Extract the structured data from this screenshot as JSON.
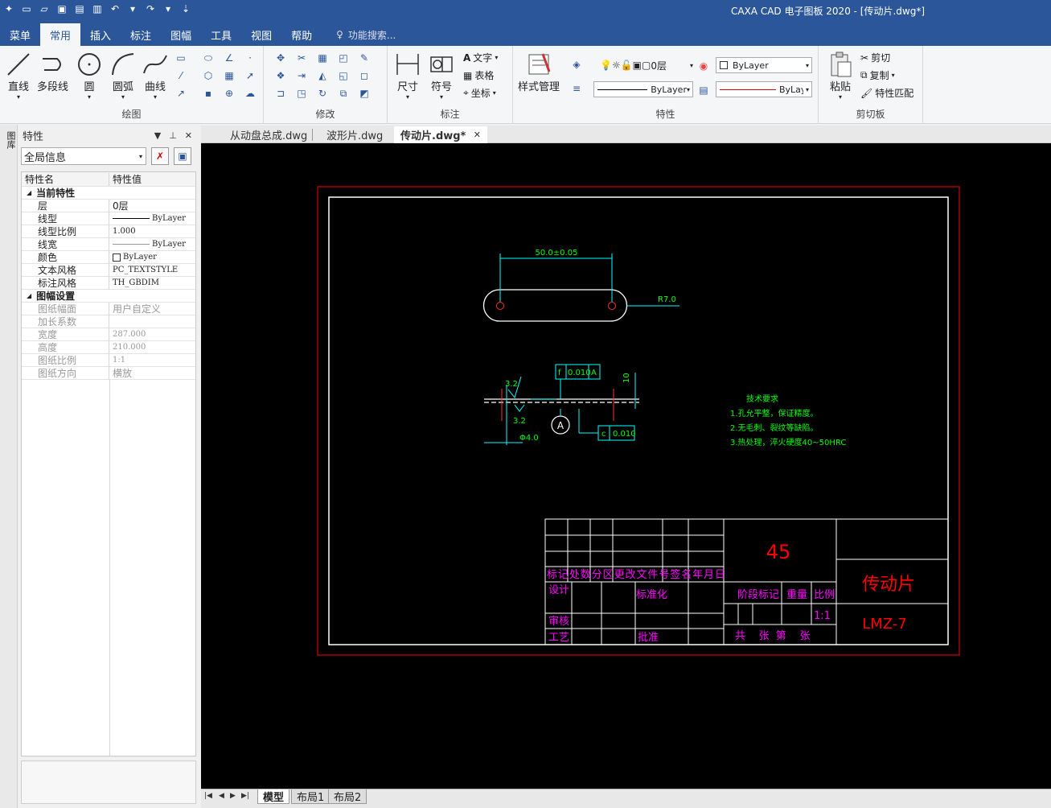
{
  "window_title": "CAXA CAD 电子图板 2020 - [传动片.dwg*]",
  "menu_tabs": [
    "菜单",
    "常用",
    "插入",
    "标注",
    "图幅",
    "工具",
    "视图",
    "帮助"
  ],
  "active_menu_tab": "常用",
  "search_placeholder": "功能搜索...",
  "ribbon": {
    "draw": {
      "label": "绘图",
      "line": "直线",
      "polyline": "多段线",
      "circle": "圆",
      "arc": "圆弧",
      "curve": "曲线"
    },
    "modify": {
      "label": "修改"
    },
    "annotate": {
      "label": "标注",
      "dimension": "尺寸",
      "symbol": "符号",
      "text": "文字",
      "table": "表格",
      "coord": "坐标"
    },
    "properties": {
      "label": "特性",
      "style_mgr": "样式管理",
      "layer": "0层",
      "color": "ByLayer",
      "linetype": "ByLayer",
      "lineweight": "ByLayer"
    },
    "clipboard": {
      "label": "剪切板",
      "paste": "粘贴",
      "cut": "剪切",
      "copy": "复制",
      "match": "特性匹配"
    }
  },
  "side_strip_label": "图库",
  "panel": {
    "title": "特性",
    "selector": "全局信息",
    "col_name": "特性名",
    "col_value": "特性值",
    "cat_current": "当前特性",
    "current": [
      {
        "name": "层",
        "value": "0层"
      },
      {
        "name": "线型",
        "value": "ByLayer"
      },
      {
        "name": "线型比例",
        "value": "1.000"
      },
      {
        "name": "线宽",
        "value": "ByLayer"
      },
      {
        "name": "颜色",
        "value": "ByLayer"
      },
      {
        "name": "文本风格",
        "value": "PC_TEXTSTYLE"
      },
      {
        "name": "标注风格",
        "value": "TH_GBDIM"
      }
    ],
    "cat_sheet": "图幅设置",
    "sheet": [
      {
        "name": "图纸幅面",
        "value": "用户自定义"
      },
      {
        "name": "加长系数",
        "value": ""
      },
      {
        "name": "宽度",
        "value": "287.000"
      },
      {
        "name": "高度",
        "value": "210.000"
      },
      {
        "name": "图纸比例",
        "value": "1:1"
      },
      {
        "name": "图纸方向",
        "value": "横放"
      }
    ]
  },
  "doc_tabs": [
    "从动盘总成.dwg",
    "波形片.dwg",
    "传动片.dwg*"
  ],
  "active_doc": "传动片.dwg*",
  "layout_tabs": [
    "模型",
    "布局1",
    "布局2"
  ],
  "drawing": {
    "dim_length": "50.0±0.05",
    "dim_radius": "R7.0",
    "rough_top": "3.2",
    "rough_bottom": "3.2",
    "tol_flat_sym": "f",
    "tol_flat_val": "0.010",
    "tol_flat_ref": "A",
    "datum": "A",
    "tol_c_sym": "c",
    "tol_c_val": "0.010",
    "dia": "Φ4.0",
    "dim_10": "10",
    "tech_title": "技术要求",
    "tech_1": "1.孔允平整，保证精度。",
    "tech_2": "2.无毛刺、裂纹等缺陷。",
    "tech_3": "3.热处理，淬火硬度40~50HRC",
    "tb_header": "标记处数分区更改文件号签名年月日",
    "tb_design": "设计",
    "tb_std": "标准化",
    "tb_review": "审核",
    "tb_process": "工艺",
    "tb_approve": "批准",
    "tb_stage": "阶段标记",
    "tb_weight": "重量",
    "tb_scale": "比例",
    "tb_scale_val": "1:1",
    "tb_sheets": "共    张  第    张",
    "tb_material": "45",
    "tb_name": "传动片",
    "tb_code": "LMZ-7"
  },
  "colors": {
    "accent": "#2b579a",
    "canvas": "#000000",
    "cad_green": "#00ff00",
    "cad_cyan": "#00ffff",
    "cad_red": "#ff0000",
    "cad_magenta": "#ff00ff"
  }
}
